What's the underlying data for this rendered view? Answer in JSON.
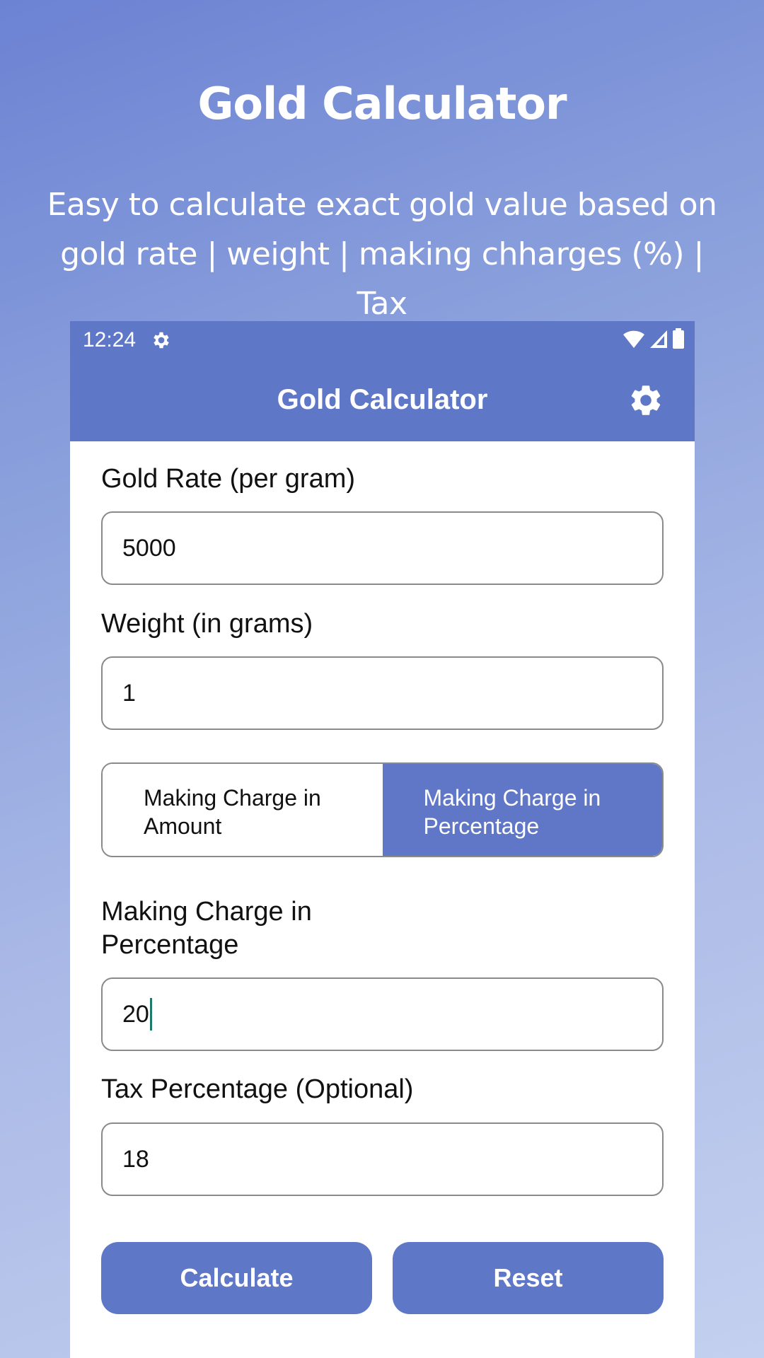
{
  "promo": {
    "title": "Gold Calculator",
    "subtitle_line1": "Easy to calculate exact gold value based on",
    "subtitle_line2": "gold rate | weight | making chharges (%) | Tax"
  },
  "statusbar": {
    "time": "12:24"
  },
  "appbar": {
    "title": "Gold Calculator"
  },
  "form": {
    "gold_rate_label": "Gold Rate (per gram)",
    "gold_rate_value": "5000",
    "weight_label": "Weight (in grams)",
    "weight_value": "1",
    "toggle": {
      "amount_line1": "Making Charge in",
      "amount_line2": "Amount",
      "percentage_line1": "Making Charge in",
      "percentage_line2": "Percentage",
      "selected": "percentage"
    },
    "making_charge_label_line1": "Making Charge in",
    "making_charge_label_line2": "Percentage",
    "making_charge_value": "20",
    "tax_label": "Tax Percentage (Optional)",
    "tax_value": "18"
  },
  "buttons": {
    "calculate": "Calculate",
    "reset": "Reset"
  },
  "colors": {
    "primary": "#5e77c6",
    "caret": "#1f7a6b"
  },
  "icons": {
    "status_settings": "gear-icon",
    "wifi": "wifi-icon",
    "signal": "signal-icon",
    "battery": "battery-icon",
    "appbar_settings": "gear-icon"
  }
}
